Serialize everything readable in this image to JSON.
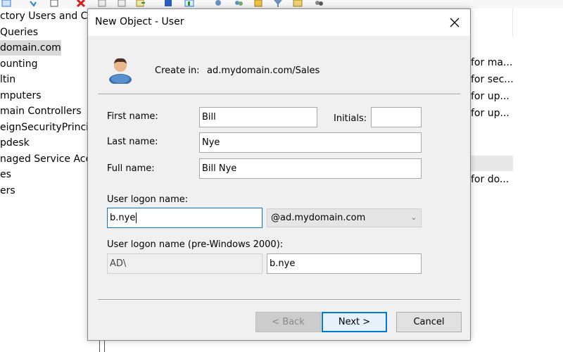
{
  "background": {
    "tree_items": [
      {
        "label": "ctory Users and Cor",
        "selected": false
      },
      {
        "label": "Queries",
        "selected": false
      },
      {
        "label": "domain.com",
        "selected": true
      },
      {
        "label": "ounting",
        "selected": false
      },
      {
        "label": "ltin",
        "selected": false
      },
      {
        "label": "mputers",
        "selected": false
      },
      {
        "label": "main Controllers",
        "selected": false
      },
      {
        "label": "eignSecurityPrincip",
        "selected": false
      },
      {
        "label": "pdesk",
        "selected": false
      },
      {
        "label": "naged Service Acco",
        "selected": false
      },
      {
        "label": "es",
        "selected": false
      },
      {
        "label": "ers",
        "selected": false
      }
    ],
    "right_items": [
      "for ma...",
      "for sec...",
      "for up...",
      "for up...",
      "for do..."
    ]
  },
  "dialog": {
    "title": "New Object - User",
    "create_in_label": "Create in:",
    "create_in_value": "ad.mydomain.com/Sales",
    "first_name_label": "First name:",
    "first_name_value": "Bill",
    "initials_label": "Initials:",
    "initials_value": "",
    "last_name_label": "Last name:",
    "last_name_value": "Nye",
    "full_name_label": "Full name:",
    "full_name_value": "Bill Nye",
    "logon_label": "User logon name:",
    "logon_value": "b.nye",
    "domain_suffix": "@ad.mydomain.com",
    "pre2000_label": "User logon name (pre-Windows 2000):",
    "pre2000_domain": "AD\\",
    "pre2000_value": "b.nye",
    "back_label": "< Back",
    "next_label": "Next >",
    "cancel_label": "Cancel"
  },
  "colors": {
    "accent": "#0078d7",
    "dialog_bg": "#f0f0f0",
    "selection_bg": "#d9d9d9"
  }
}
